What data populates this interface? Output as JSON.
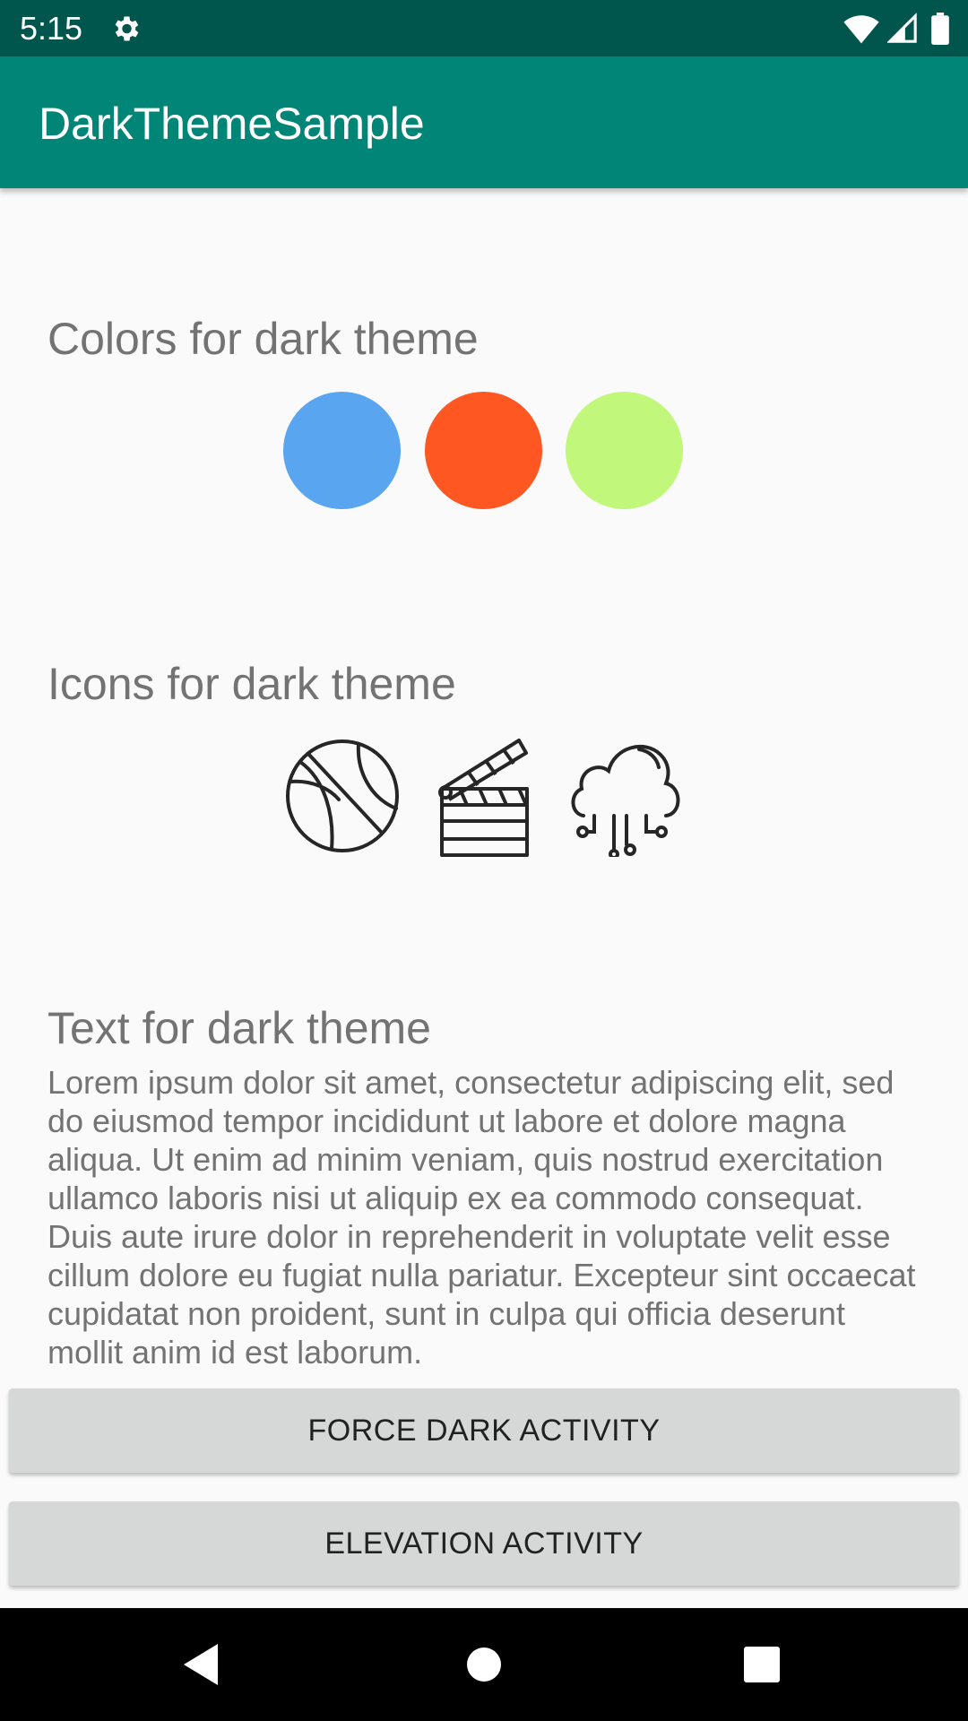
{
  "status_bar": {
    "time": "5:15",
    "icons": [
      "gear-icon",
      "wifi-icon",
      "signal-icon",
      "battery-icon"
    ]
  },
  "app_bar": {
    "title": "DarkThemeSample",
    "color": "#008577"
  },
  "sections": {
    "colors_title": "Colors for dark theme",
    "swatches": [
      "#5aa5f0",
      "#ff5722",
      "#c1f77a"
    ],
    "icons_title": "Icons for dark theme",
    "icon_names": [
      "basketball-icon",
      "clapperboard-icon",
      "cloud-circuit-icon"
    ],
    "text_title": "Text for dark theme",
    "body_text": "Lorem ipsum dolor sit amet, consectetur adipiscing elit, sed do eiusmod tempor incididunt ut labore et dolore magna aliqua. Ut enim ad minim veniam, quis nostrud exercitation ullamco laboris nisi ut aliquip ex ea commodo consequat. Duis aute irure dolor in reprehenderit in voluptate velit esse cillum dolore eu fugiat nulla pariatur. Excepteur sint occaecat cupidatat non proident, sunt in culpa qui officia deserunt mollit anim id est laborum."
  },
  "buttons": {
    "force_dark": "FORCE DARK ACTIVITY",
    "elevation": "ELEVATION ACTIVITY"
  },
  "nav_bar": {
    "icons": [
      "back-icon",
      "home-icon",
      "recents-icon"
    ]
  }
}
